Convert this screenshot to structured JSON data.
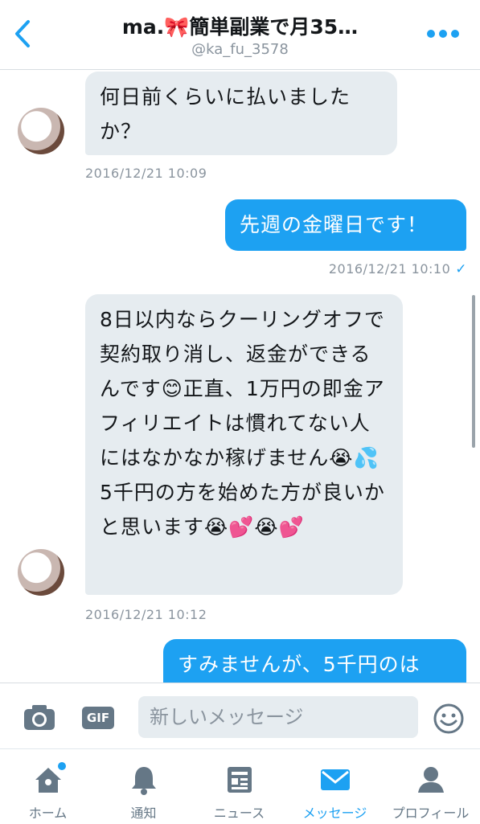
{
  "header": {
    "title": "ma.🎀簡単副業で月35…",
    "handle": "@ka_fu_3578"
  },
  "messages": [
    {
      "direction": "in",
      "text": "何日前くらいに払いましたか？",
      "timestamp": "2016/12/21 10:09"
    },
    {
      "direction": "out",
      "text": "先週の金曜日です！",
      "timestamp": "2016/12/21 10:10",
      "status": "✓"
    },
    {
      "direction": "in",
      "text": "8日以内ならクーリングオフで契約取り消し、返金ができるんです😊正直、1万円の即金アフィリエイトは慣れてない人にはなかなか稼げません😭💦5千円の方を始めた方が良いかと思います😭💕😭💕",
      "timestamp": "2016/12/21 10:12"
    },
    {
      "direction": "out",
      "text": "すみませんが、5千円のは"
    }
  ],
  "composer": {
    "placeholder": "新しいメッセージ",
    "gif_label": "GIF"
  },
  "tabs": [
    {
      "label": "ホーム",
      "icon": "home-icon",
      "active": false,
      "badge": true
    },
    {
      "label": "通知",
      "icon": "bell-icon",
      "active": false
    },
    {
      "label": "ニュース",
      "icon": "news-icon",
      "active": false
    },
    {
      "label": "メッセージ",
      "icon": "envelope-icon",
      "active": true
    },
    {
      "label": "プロフィール",
      "icon": "person-icon",
      "active": false
    }
  ],
  "colors": {
    "accent": "#1da1f2",
    "incoming_bubble": "#e6ecf0",
    "muted_text": "#8a949e",
    "icon_gray": "#657786"
  }
}
